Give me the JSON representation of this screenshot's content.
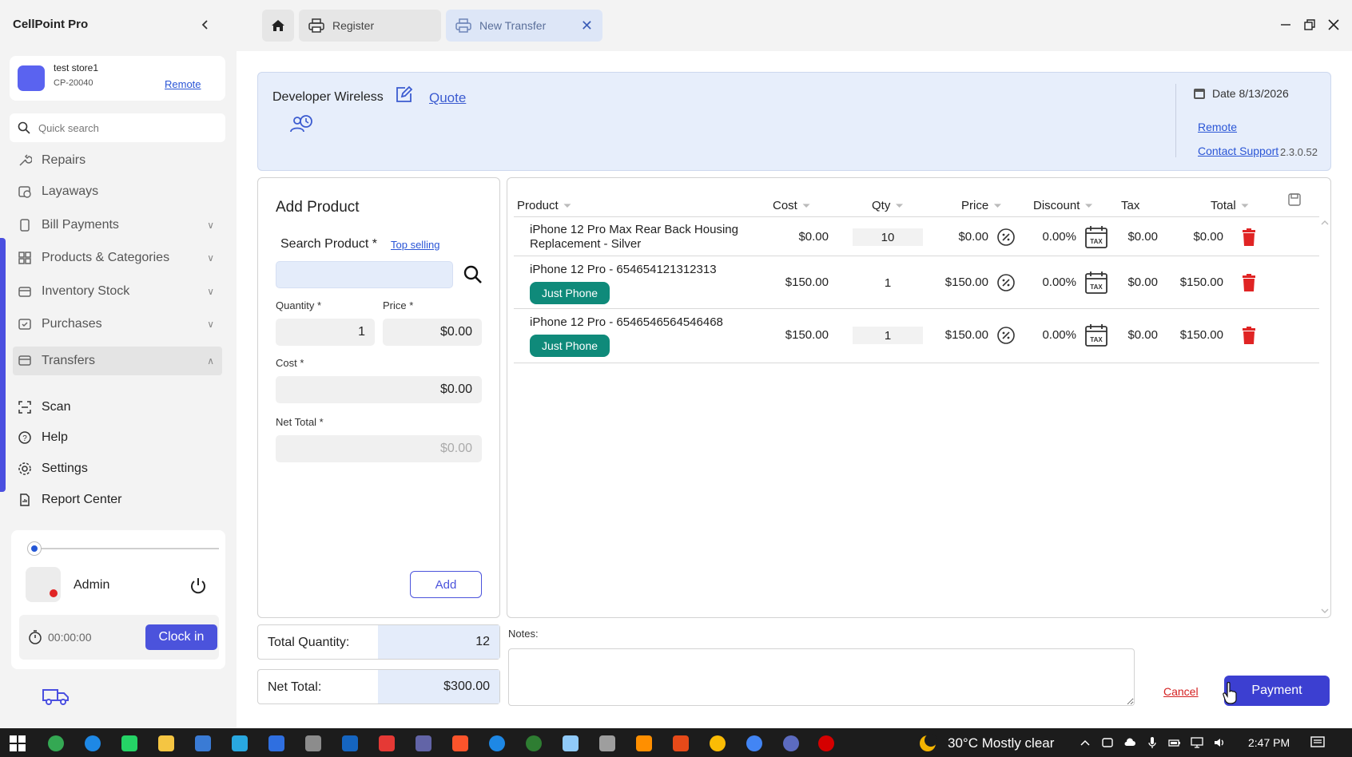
{
  "app": {
    "title": "CellPoint Pro"
  },
  "tabs": [
    {
      "label": "Register"
    },
    {
      "label": "New Transfer"
    }
  ],
  "store": {
    "name": "test store1",
    "code": "CP-20040",
    "remote_label": "Remote"
  },
  "search": {
    "placeholder": "Quick search"
  },
  "nav": [
    {
      "label": "Repairs"
    },
    {
      "label": "Layaways"
    },
    {
      "label": "Bill Payments"
    },
    {
      "label": "Products & Categories"
    },
    {
      "label": "Inventory Stock"
    },
    {
      "label": "Purchases"
    },
    {
      "label": "Transfers"
    },
    {
      "label": "Scan"
    },
    {
      "label": "Help"
    },
    {
      "label": "Settings"
    },
    {
      "label": "Report Center"
    }
  ],
  "user": {
    "name": "Admin",
    "timer": "00:00:00",
    "clock_in_label": "Clock in"
  },
  "header": {
    "customer": "Developer Wireless",
    "quote_label": "Quote",
    "date": "Date 8/13/2026",
    "remote_label": "Remote",
    "support_label": "Contact Support",
    "version": "2.3.0.52"
  },
  "add_product": {
    "title": "Add Product",
    "search_label": "Search Product *",
    "top_selling": "Top selling",
    "quantity_label": "Quantity *",
    "price_label": "Price *",
    "cost_label": "Cost *",
    "net_total_label": "Net Total *",
    "quantity": "1",
    "price": "$0.00",
    "cost": "$0.00",
    "net_total": "$0.00",
    "add_label": "Add"
  },
  "totals": {
    "quantity_label": "Total Quantity:",
    "quantity": "12",
    "net_label": "Net Total:",
    "net": "$300.00"
  },
  "grid": {
    "columns": [
      "Product",
      "Cost",
      "Qty",
      "Price",
      "Discount",
      "Tax",
      "Total"
    ],
    "rows": [
      {
        "product_line1": "iPhone 12 Pro Max Rear Back Housing",
        "product_line2": "Replacement - Silver",
        "badge": "",
        "cost": "$0.00",
        "qty": "10",
        "price": "$0.00",
        "discount": "0.00%",
        "tax": "$0.00",
        "total": "$0.00"
      },
      {
        "product_line1": "iPhone 12 Pro - 654654121312313",
        "product_line2": "",
        "badge": "Just Phone",
        "cost": "$150.00",
        "qty": "1",
        "price": "$150.00",
        "discount": "0.00%",
        "tax": "$0.00",
        "total": "$150.00"
      },
      {
        "product_line1": "iPhone 12 Pro - 6546546564546468",
        "product_line2": "",
        "badge": "Just Phone",
        "cost": "$150.00",
        "qty": "1",
        "price": "$150.00",
        "discount": "0.00%",
        "tax": "$0.00",
        "total": "$150.00"
      }
    ]
  },
  "notes": {
    "label": "Notes:"
  },
  "actions": {
    "cancel_label": "Cancel",
    "payment_label": "Payment"
  },
  "taskbar": {
    "weather": "30°C  Mostly clear",
    "time": "2:47 PM"
  },
  "colors": {
    "accent": "#4b53dc",
    "badge": "#0f8a7a",
    "delete": "#e02424",
    "header_bg": "#e7eefb"
  }
}
